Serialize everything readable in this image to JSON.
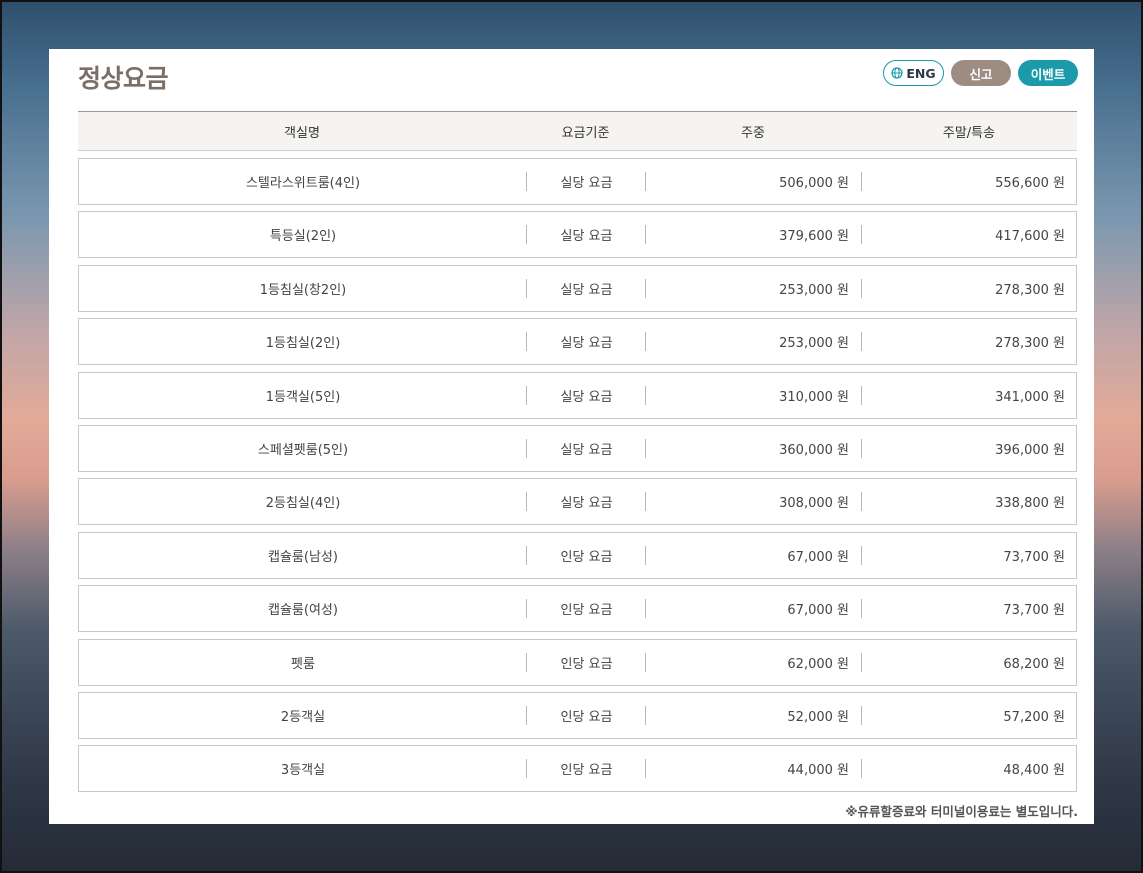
{
  "header": {
    "title": "정상요금",
    "eng_label": "ENG",
    "report_label": "신고",
    "event_label": "이벤트"
  },
  "table": {
    "columns": [
      "객실명",
      "요금기준",
      "주중",
      "주말/특송"
    ],
    "rows": [
      {
        "room": "스텔라스위트룸(4인)",
        "basis": "실당 요금",
        "weekday": "506,000 원",
        "weekend": "556,600 원"
      },
      {
        "room": "특등실(2인)",
        "basis": "실당 요금",
        "weekday": "379,600 원",
        "weekend": "417,600 원"
      },
      {
        "room": "1등침실(창2인)",
        "basis": "실당 요금",
        "weekday": "253,000 원",
        "weekend": "278,300 원"
      },
      {
        "room": "1등침실(2인)",
        "basis": "실당 요금",
        "weekday": "253,000 원",
        "weekend": "278,300 원"
      },
      {
        "room": "1등객실(5인)",
        "basis": "실당 요금",
        "weekday": "310,000 원",
        "weekend": "341,000 원"
      },
      {
        "room": "스페셜펫룸(5인)",
        "basis": "실당 요금",
        "weekday": "360,000 원",
        "weekend": "396,000 원"
      },
      {
        "room": "2등침실(4인)",
        "basis": "실당 요금",
        "weekday": "308,000 원",
        "weekend": "338,800 원"
      },
      {
        "room": "캡슐룸(남성)",
        "basis": "인당 요금",
        "weekday": "67,000 원",
        "weekend": "73,700 원"
      },
      {
        "room": "캡슐룸(여성)",
        "basis": "인당 요금",
        "weekday": "67,000 원",
        "weekend": "73,700 원"
      },
      {
        "room": "펫룸",
        "basis": "인당 요금",
        "weekday": "62,000 원",
        "weekend": "68,200 원"
      },
      {
        "room": "2등객실",
        "basis": "인당 요금",
        "weekday": "52,000 원",
        "weekend": "57,200 원"
      },
      {
        "room": "3등객실",
        "basis": "인당 요금",
        "weekday": "44,000 원",
        "weekend": "48,400 원"
      }
    ]
  },
  "footnote": "※유류할증료와 터미널이용료는 별도입니다.",
  "colors": {
    "accent": "#1b9aaa",
    "report_button": "#9c8c82",
    "title": "#7a6e66"
  }
}
